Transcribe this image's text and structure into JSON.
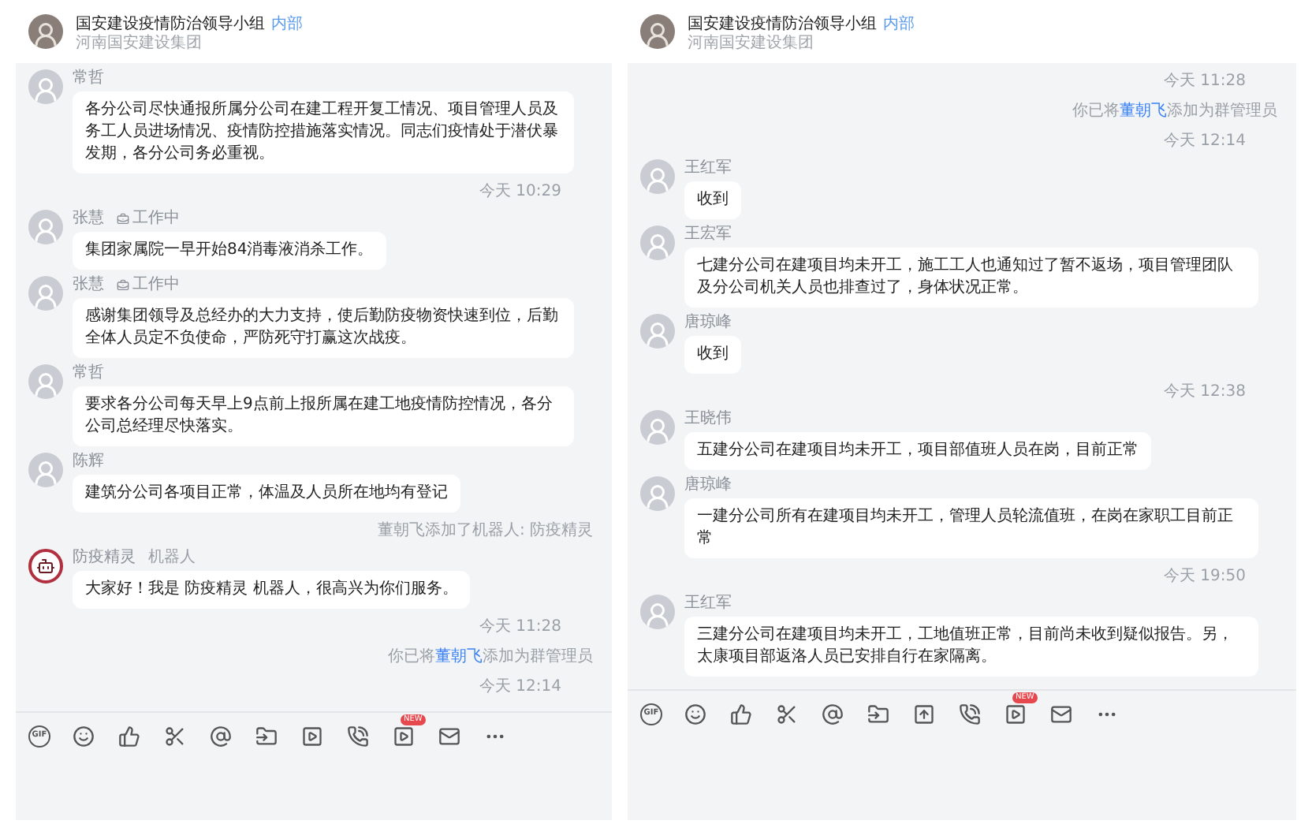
{
  "panels": [
    {
      "header": {
        "title": "国安建设疫情防治领导小组",
        "badge": "内部",
        "subtitle": "河南国安建设集团"
      },
      "items": [
        {
          "kind": "message",
          "sender": "常哲",
          "text": "各分公司尽快通报所属分公司在建工程开复工情况、项目管理人员及务工人员进场情况、疫情防控措施落实情况。同志们疫情处于潜伏暴发期，各分公司务必重视。"
        },
        {
          "kind": "time",
          "text": "今天 10:29"
        },
        {
          "kind": "message",
          "sender": "张慧",
          "status": "工作中",
          "text": "集团家属院一早开始84消毒液消杀工作。"
        },
        {
          "kind": "message",
          "sender": "张慧",
          "status": "工作中",
          "text": "感谢集团领导及总经办的大力支持，使后勤防疫物资快速到位，后勤全体人员定不负使命，严防死守打赢这次战疫。"
        },
        {
          "kind": "message",
          "sender": "常哲",
          "text": "要求各分公司每天早上9点前上报所属在建工地疫情防控情况，各分公司总经理尽快落实。"
        },
        {
          "kind": "message",
          "sender": "陈辉",
          "text": "建筑分公司各项目正常，体温及人员所在地均有登记"
        },
        {
          "kind": "system",
          "before": "董朝飞添加了机器人: 防疫精灵"
        },
        {
          "kind": "message",
          "sender": "防疫精灵",
          "tag": "机器人",
          "robot": true,
          "text": "大家好！我是 防疫精灵 机器人，很高兴为你们服务。"
        },
        {
          "kind": "time",
          "text": "今天 11:28"
        },
        {
          "kind": "system",
          "before": "你已将",
          "link": "董朝飞",
          "after": "添加为群管理员"
        },
        {
          "kind": "time",
          "text": "今天 12:14"
        }
      ],
      "toolbar": [
        {
          "kind": "gif",
          "label": "GIF"
        },
        {
          "kind": "smile"
        },
        {
          "kind": "like"
        },
        {
          "kind": "scissors"
        },
        {
          "kind": "at"
        },
        {
          "kind": "folder"
        },
        {
          "kind": "play"
        },
        {
          "kind": "phone"
        },
        {
          "kind": "video",
          "badge": "NEW"
        },
        {
          "kind": "mail"
        },
        {
          "kind": "more"
        }
      ]
    },
    {
      "header": {
        "title": "国安建设疫情防治领导小组",
        "badge": "内部",
        "subtitle": "河南国安建设集团"
      },
      "items": [
        {
          "kind": "time",
          "text": "今天 11:28"
        },
        {
          "kind": "system",
          "before": "你已将",
          "link": "董朝飞",
          "after": "添加为群管理员"
        },
        {
          "kind": "time",
          "text": "今天 12:14"
        },
        {
          "kind": "message",
          "sender": "王红军",
          "text": "收到"
        },
        {
          "kind": "message",
          "sender": "王宏军",
          "text": "七建分公司在建项目均未开工，施工工人也通知过了暂不返场，项目管理团队及分公司机关人员也排查过了，身体状况正常。"
        },
        {
          "kind": "message",
          "sender": "唐琼峰",
          "text": "收到"
        },
        {
          "kind": "time",
          "text": "今天 12:38"
        },
        {
          "kind": "message",
          "sender": "王晓伟",
          "text": "五建分公司在建项目均未开工，项目部值班人员在岗，目前正常"
        },
        {
          "kind": "message",
          "sender": "唐琼峰",
          "text": "一建分公司所有在建项目均未开工，管理人员轮流值班，在岗在家职工目前正常"
        },
        {
          "kind": "time",
          "text": "今天 19:50"
        },
        {
          "kind": "message",
          "sender": "王红军",
          "text": "三建分公司在建项目均未开工，工地值班正常，目前尚未收到疑似报告。另，太康项目部返洛人员已安排自行在家隔离。"
        }
      ],
      "toolbar": [
        {
          "kind": "gif",
          "label": "GIF"
        },
        {
          "kind": "smile"
        },
        {
          "kind": "like"
        },
        {
          "kind": "scissors"
        },
        {
          "kind": "at"
        },
        {
          "kind": "folder"
        },
        {
          "kind": "upload"
        },
        {
          "kind": "phone"
        },
        {
          "kind": "video",
          "badge": "NEW"
        },
        {
          "kind": "mail"
        },
        {
          "kind": "more"
        }
      ]
    }
  ]
}
